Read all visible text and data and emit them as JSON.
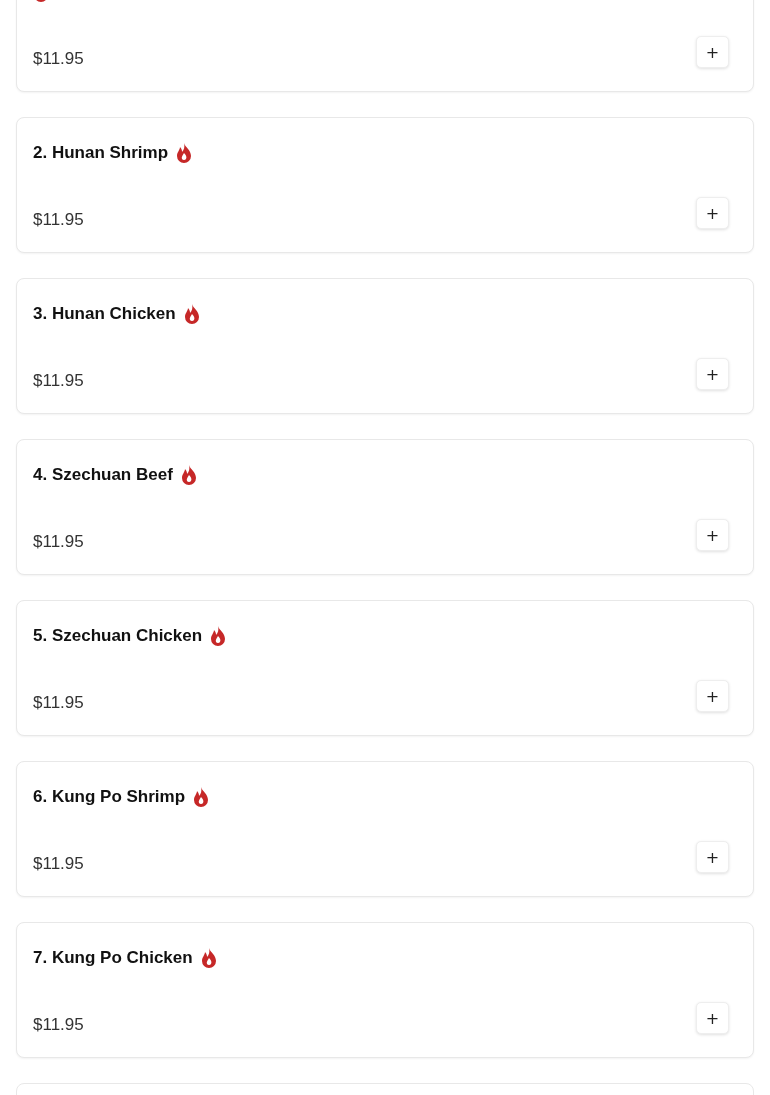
{
  "menu_items": [
    {
      "spicy": true,
      "price": "$11.95",
      "add_label": "+"
    },
    {
      "name": "2. Hunan Shrimp",
      "spicy": true,
      "price": "$11.95",
      "add_label": "+"
    },
    {
      "name": "3. Hunan Chicken",
      "spicy": true,
      "price": "$11.95",
      "add_label": "+"
    },
    {
      "name": "4. Szechuan Beef",
      "spicy": true,
      "price": "$11.95",
      "add_label": "+"
    },
    {
      "name": "5. Szechuan Chicken",
      "spicy": true,
      "price": "$11.95",
      "add_label": "+"
    },
    {
      "name": "6. Kung Po Shrimp",
      "spicy": true,
      "price": "$11.95",
      "add_label": "+"
    },
    {
      "name": "7. Kung Po Chicken",
      "spicy": true,
      "price": "$11.95",
      "add_label": "+"
    }
  ]
}
